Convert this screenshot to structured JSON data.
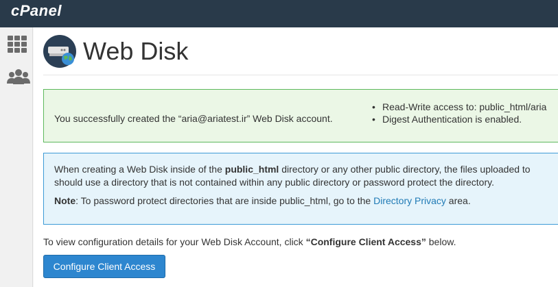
{
  "app": {
    "logo_text": "cPanel"
  },
  "sidebar": {
    "items": [
      {
        "icon": "grid-icon"
      },
      {
        "icon": "users-icon"
      }
    ]
  },
  "header": {
    "title": "Web Disk",
    "icon": "web-disk-icon"
  },
  "success_alert": {
    "message": "You successfully created the “aria@ariatest.ir” Web Disk account.",
    "bullets": [
      "Read-Write access to: public_html/aria",
      "Digest Authentication is enabled."
    ]
  },
  "info_alert": {
    "line1_prefix": "When creating a Web Disk inside of the ",
    "line1_bold": "public_html",
    "line1_suffix": " directory or any other public directory, the files uploaded to",
    "line2": "should use a directory that is not contained within any public directory or password protect the directory.",
    "note_label": "Note",
    "note_prefix": ": To password protect directories that are inside public_html, go to the ",
    "note_link": "Directory Privacy",
    "note_suffix": " area."
  },
  "config": {
    "text_prefix": "To view configuration details for your Web Disk Account, click ",
    "text_bold": "“Configure Client Access”",
    "text_suffix": " below.",
    "button_label": "Configure Client Access"
  },
  "colors": {
    "topbar": "#293a4a",
    "success_border": "#5cb85c",
    "success_bg": "#ebf7e6",
    "info_border": "#3b9ad6",
    "info_bg": "#e6f4fb",
    "link": "#1f7ab5",
    "button": "#2d86cf"
  }
}
